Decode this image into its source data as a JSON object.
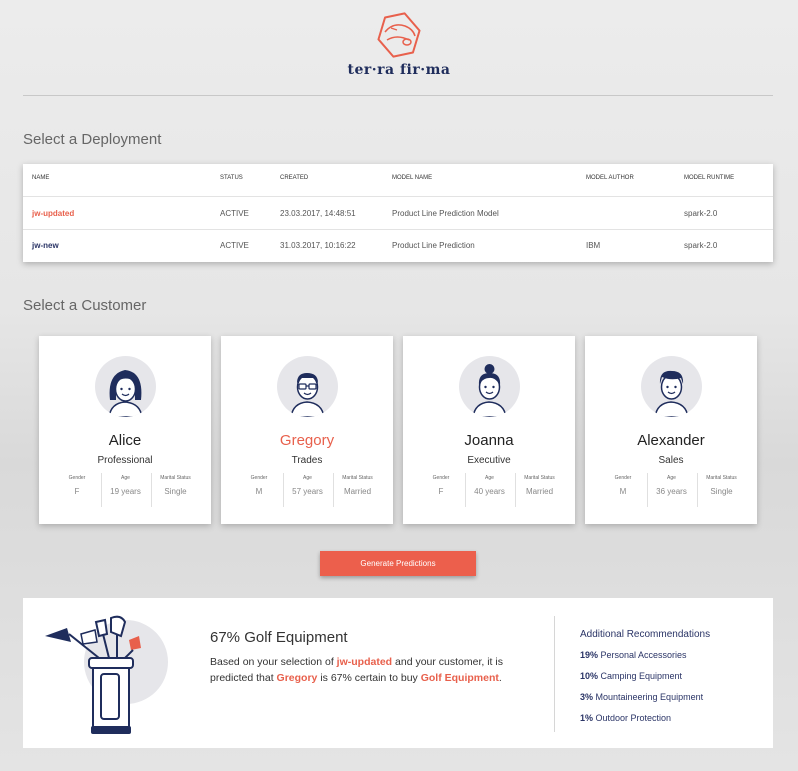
{
  "brand": {
    "logo_text": "ter·ra fir·ma"
  },
  "deployment_section": {
    "title": "Select a Deployment"
  },
  "deployments": {
    "headers": [
      "NAME",
      "STATUS",
      "CREATED",
      "MODEL NAME",
      "MODEL AUTHOR",
      "MODEL RUNTIME"
    ],
    "rows": [
      {
        "name": "jw-updated",
        "status": "ACTIVE",
        "created": "23.03.2017, 14:48:51",
        "model_name": "Product Line Prediction Model",
        "model_author": "",
        "model_runtime": "spark-2.0"
      },
      {
        "name": "jw-new",
        "status": "ACTIVE",
        "created": "31.03.2017, 10:16:22",
        "model_name": "Product Line Prediction",
        "model_author": "IBM",
        "model_runtime": "spark-2.0"
      }
    ]
  },
  "customer_section": {
    "title": "Select a Customer"
  },
  "customers": [
    {
      "name": "Alice",
      "occupation": "Professional",
      "gender_label": "Gender",
      "gender": "F",
      "age_label": "Age",
      "age": "19 years",
      "marital_label": "Marital Status",
      "marital": "Single"
    },
    {
      "name": "Gregory",
      "occupation": "Trades",
      "gender_label": "Gender",
      "gender": "M",
      "age_label": "Age",
      "age": "57 years",
      "marital_label": "Marital Status",
      "marital": "Married"
    },
    {
      "name": "Joanna",
      "occupation": "Executive",
      "gender_label": "Gender",
      "gender": "F",
      "age_label": "Age",
      "age": "40 years",
      "marital_label": "Marital Status",
      "marital": "Married"
    },
    {
      "name": "Alexander",
      "occupation": "Sales",
      "gender_label": "Gender",
      "gender": "M",
      "age_label": "Age",
      "age": "36 years",
      "marital_label": "Marital Status",
      "marital": "Single"
    }
  ],
  "generate_button": {
    "label": "Generate Predictions"
  },
  "result": {
    "title": "67% Golf Equipment",
    "text_1": "Based on your selection of ",
    "deployment": "jw-updated",
    "text_2": " and your customer, it is predicted that ",
    "customer": "Gregory",
    "text_3": " is 67% certain to buy ",
    "product": "Golf Equipment",
    "text_4": "."
  },
  "recommendations": {
    "title": "Additional Recommendations",
    "items": [
      {
        "percent": "19%",
        "label": " Personal Accessories"
      },
      {
        "percent": "10%",
        "label": " Camping Equipment"
      },
      {
        "percent": "3%",
        "label": " Mountaineering Equipment"
      },
      {
        "percent": "1%",
        "label": " Outdoor Protection"
      }
    ]
  },
  "colors": {
    "accent": "#e8604c",
    "navy": "#2a3466",
    "button": "#ec5f4c"
  }
}
